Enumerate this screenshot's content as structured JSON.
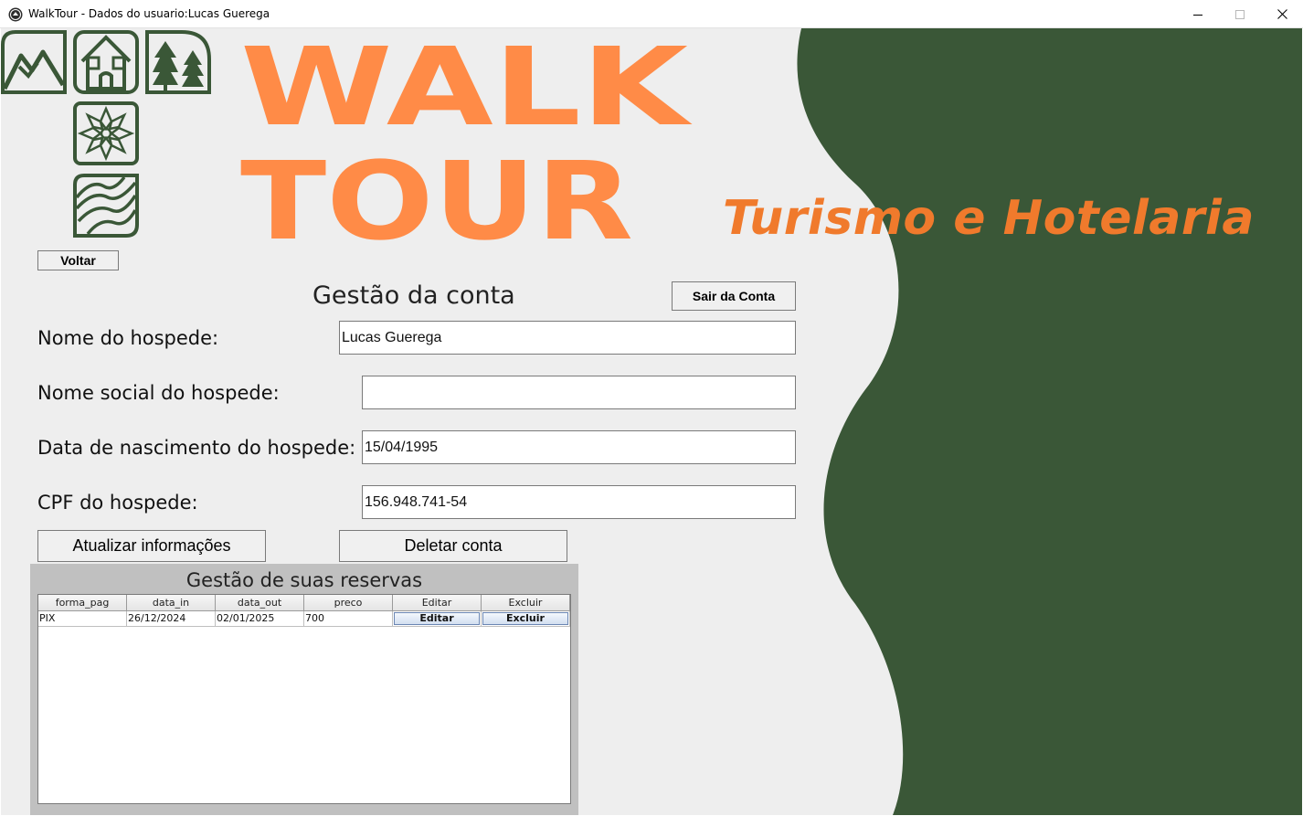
{
  "window": {
    "title": "WalkTour - Dados do usuario:Lucas Guerega",
    "controls": [
      "minimize-icon",
      "maximize-icon",
      "close-icon"
    ]
  },
  "colors": {
    "brand_orange": "#ff8b47",
    "tagline_orange": "#f07a2c",
    "forest_green": "#3a5737",
    "background": "#eeeeee",
    "panel_gray": "#c0c0c0"
  },
  "logo": {
    "icons": [
      "mountains-icon",
      "house-icon",
      "pine-trees-icon",
      "flower-icon",
      "waves-icon"
    ],
    "brand_line1": "WALK",
    "brand_line2": "TOUR",
    "tagline": "Turismo e Hotelaria"
  },
  "nav": {
    "back_label": "Voltar"
  },
  "account": {
    "title": "Gestão da conta",
    "logout_label": "Sair da Conta",
    "fields": {
      "name": {
        "label": "Nome do hospede:",
        "value": "Lucas Guerega"
      },
      "social_name": {
        "label": "Nome social do hospede:",
        "value": ""
      },
      "birth_date": {
        "label": "Data de nascimento do hospede:",
        "value": "15/04/1995"
      },
      "cpf": {
        "label": "CPF do hospede:",
        "value": "156.948.741-54"
      }
    },
    "update_label": "Atualizar informações",
    "delete_label": "Deletar conta"
  },
  "reservations": {
    "title": "Gestão de suas reservas",
    "columns": [
      "forma_pag",
      "data_in",
      "data_out",
      "preco",
      "Editar",
      "Excluir"
    ],
    "rows": [
      {
        "forma_pag": "PIX",
        "data_in": "26/12/2024",
        "data_out": "02/01/2025",
        "preco": "700",
        "edit_label": "Editar",
        "delete_label": "Excluir"
      }
    ]
  }
}
